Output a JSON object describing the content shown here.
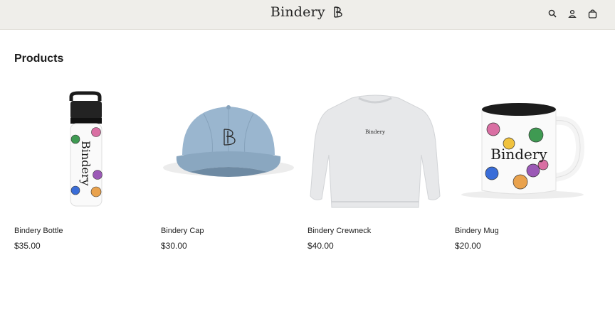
{
  "header": {
    "brand": "Bindery",
    "icons": [
      "search-icon",
      "account-icon",
      "cart-icon"
    ]
  },
  "section": {
    "title": "Products"
  },
  "products": [
    {
      "name": "Bindery Bottle",
      "price": "$35.00",
      "image": "water-bottle"
    },
    {
      "name": "Bindery Cap",
      "price": "$30.00",
      "image": "baseball-cap"
    },
    {
      "name": "Bindery Crewneck",
      "price": "$40.00",
      "image": "crewneck-sweatshirt"
    },
    {
      "name": "Bindery Mug",
      "price": "$20.00",
      "image": "mug"
    }
  ],
  "product_print": {
    "bottle": "Bindery",
    "crewneck": "Bindery",
    "mug": "Bindery"
  },
  "colors": {
    "header_bg": "#efeeea",
    "cap": "#9ab6cf",
    "crewneck": "#e7e8ea"
  }
}
